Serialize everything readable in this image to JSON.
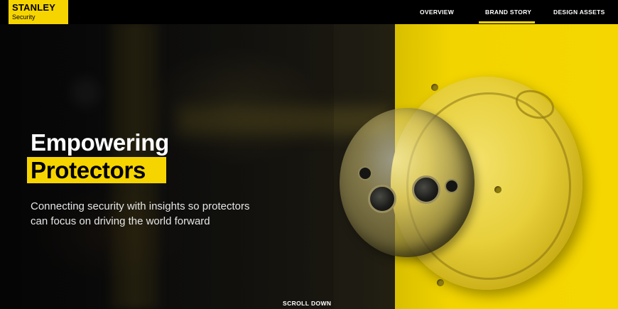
{
  "brand": {
    "name": "STANLEY",
    "sub": "Security"
  },
  "nav": {
    "items": [
      {
        "label": "OVERVIEW"
      },
      {
        "label": "BRAND STORY"
      },
      {
        "label": "DESIGN ASSETS"
      }
    ],
    "active": "BRAND STORY"
  },
  "hero": {
    "title_line1": "Empowering",
    "title_line2": "Protectors",
    "subtitle": "Connecting security with insights so protectors can focus on driving the world forward",
    "scroll_label": "SCROLL DOWN"
  },
  "colors": {
    "accent": "#f6d400",
    "nav_bg": "#000000",
    "text_light": "#ffffff"
  },
  "icons": {
    "hero_image": "security-camera-image"
  }
}
